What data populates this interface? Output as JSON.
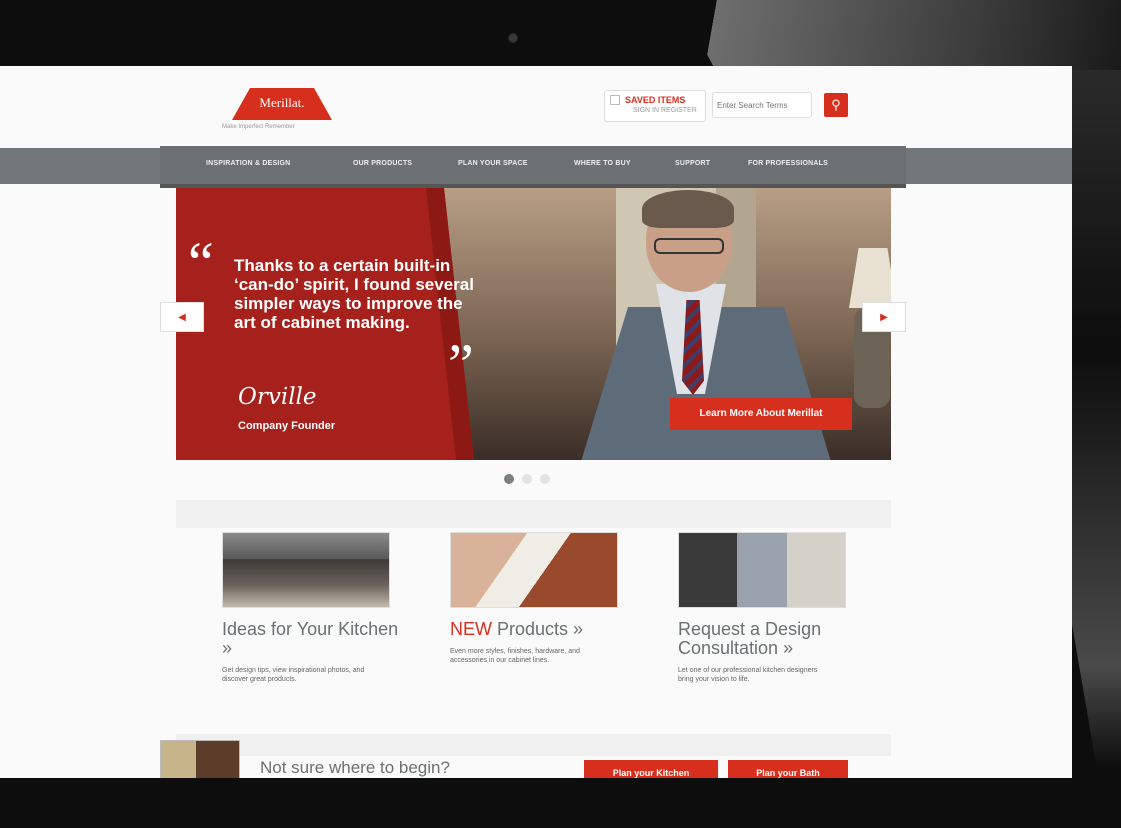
{
  "header": {
    "logo_text": "Merillat.",
    "logo_tagline": "Make Imperfect Remember",
    "saved_items": {
      "title": "SAVED ITEMS",
      "links": "SIGN IN  REGISTER"
    },
    "search": {
      "placeholder": "Enter Search Terms"
    }
  },
  "nav": {
    "items": [
      {
        "label": "INSPIRATION & DESIGN"
      },
      {
        "label": "OUR PRODUCTS"
      },
      {
        "label": "PLAN YOUR SPACE"
      },
      {
        "label": "WHERE TO BUY"
      },
      {
        "label": "SUPPORT"
      },
      {
        "label": "FOR PROFESSIONALS"
      }
    ]
  },
  "hero": {
    "quote_open": "“",
    "quote": "Thanks to a certain built-in ‘can-do’ spirit, I found several simpler ways to improve the art of cabinet making.",
    "quote_close": "”",
    "signature": "Orville",
    "role": "Company Founder",
    "cta_label": "Learn More About Merillat",
    "prev_arrow": "◀",
    "next_arrow": "▶",
    "slides_total": 3,
    "slide_active": 1
  },
  "features": [
    {
      "title": "Ideas for Your Kitchen »",
      "desc": "Get design tips, view inspirational photos, and discover great products."
    },
    {
      "title_accent": "NEW",
      "title": "Products »",
      "desc": "Even more styles, finishes, hardware, and accessories in our cabinet lines."
    },
    {
      "title": "Request a Design Consultation »",
      "desc": "Let one of our professional kitchen designers bring your vision to life."
    }
  ],
  "bottom": {
    "question": "Not sure where to begin?",
    "plan_kitchen": "Plan your Kitchen",
    "plan_bath": "Plan your Bath"
  },
  "colors": {
    "brand_red": "#d72f1e",
    "nav_gray": "#6b7072",
    "hero_red": "#a6201c"
  },
  "icons": {
    "search": "search-icon",
    "saved": "saved-items-icon",
    "prev": "chevron-left-icon",
    "next": "chevron-right-icon"
  }
}
